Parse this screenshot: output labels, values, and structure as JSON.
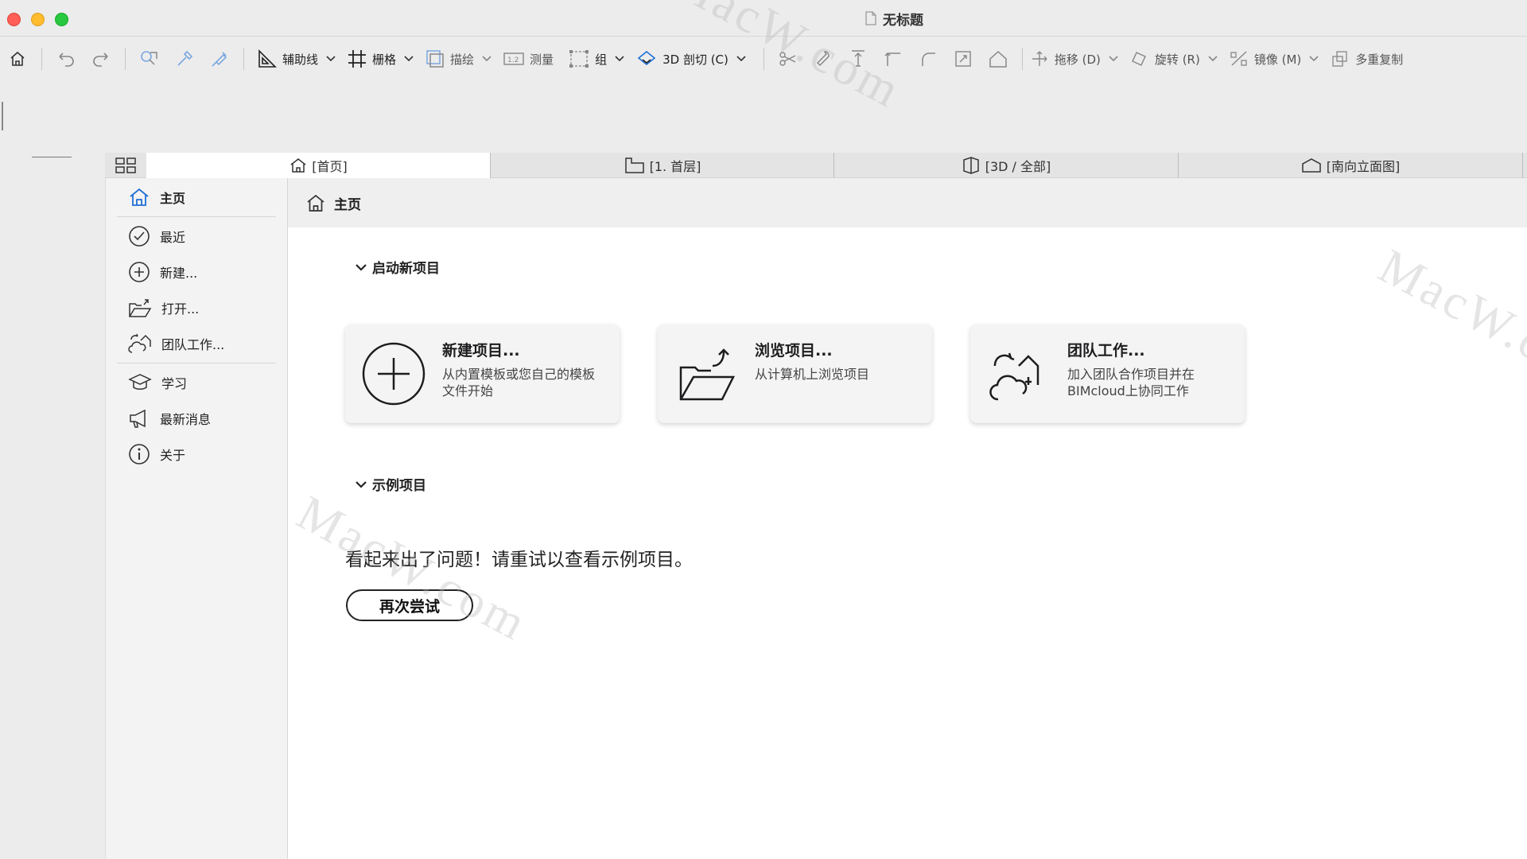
{
  "window": {
    "title": "无标题",
    "file_icon": "document-icon"
  },
  "toolbar": {
    "guides_label": "辅助线",
    "grid_label": "栅格",
    "trace_label": "描绘",
    "measure_label": "测量",
    "group_label": "组",
    "section3d_label": "3D 剖切 (C)",
    "drag_label": "拖移 (D)",
    "rotate_label": "旋转 (R)",
    "mirror_label": "镜像 (M)",
    "multiply_label": "多重复制"
  },
  "tabs": [
    {
      "label": "[首页]",
      "icon": "home-icon"
    },
    {
      "label": "[1. 首层]",
      "icon": "floor-plan-icon"
    },
    {
      "label": "[3D / 全部]",
      "icon": "3d-box-icon"
    },
    {
      "label": "[南向立面图]",
      "icon": "elevation-icon"
    }
  ],
  "sidebar": {
    "items": [
      {
        "label": "主页",
        "icon": "home-icon"
      },
      {
        "label": "最近",
        "icon": "clock-icon"
      },
      {
        "label": "新建...",
        "icon": "plus-circle-icon"
      },
      {
        "label": "打开...",
        "icon": "open-folder-icon"
      },
      {
        "label": "团队工作...",
        "icon": "teamwork-icon"
      },
      {
        "label": "学习",
        "icon": "graduation-cap-icon"
      },
      {
        "label": "最新消息",
        "icon": "megaphone-icon"
      },
      {
        "label": "关于",
        "icon": "info-icon"
      }
    ]
  },
  "main": {
    "header_title": "主页",
    "start_section": "启动新项目",
    "cards": [
      {
        "title": "新建项目...",
        "desc": "从内置模板或您自己的模板文件开始",
        "icon": "plus-circle-icon"
      },
      {
        "title": "浏览项目...",
        "desc": "从计算机上浏览项目",
        "icon": "open-folder-icon"
      },
      {
        "title": "团队工作...",
        "desc": "加入团队合作项目并在BIMcloud上协同工作",
        "icon": "teamwork-cloud-icon"
      }
    ],
    "examples_section": "示例项目",
    "error_message": "看起来出了问题！请重试以查看示例项目。",
    "retry_label": "再次尝试"
  },
  "watermark": "MacW.com",
  "colors": {
    "accent": "#1f6fd6",
    "close": "#ff5f57",
    "minimize": "#febc2e",
    "zoom": "#28c840"
  }
}
